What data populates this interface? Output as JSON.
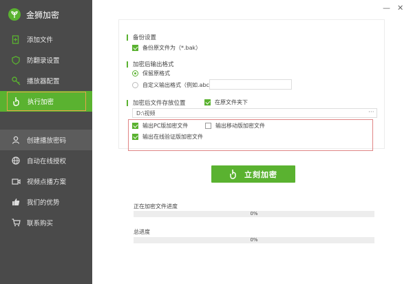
{
  "app": {
    "title": "金狮加密"
  },
  "window": {
    "minimize": "—",
    "close": "✕"
  },
  "nav_primary": [
    {
      "id": "add",
      "label": "添加文件",
      "icon": "add-file-icon"
    },
    {
      "id": "anti",
      "label": "防翻录设置",
      "icon": "shield-icon"
    },
    {
      "id": "player",
      "label": "播放器配置",
      "icon": "key-icon"
    },
    {
      "id": "exec",
      "label": "执行加密",
      "icon": "finger-icon",
      "active": true
    }
  ],
  "nav_secondary": [
    {
      "id": "pwd",
      "label": "创建播放密码",
      "icon": "user-icon",
      "selected": true
    },
    {
      "id": "auth",
      "label": "自动在线授权",
      "icon": "globe-icon"
    },
    {
      "id": "vod",
      "label": "视频点播方案",
      "icon": "video-icon"
    },
    {
      "id": "adv",
      "label": "我们的优势",
      "icon": "thumbs-up-icon"
    },
    {
      "id": "buy",
      "label": "联系购买",
      "icon": "cart-icon"
    }
  ],
  "backup": {
    "title": "备份设置",
    "option_label": "备份原文件为（*.bak）",
    "checked": true
  },
  "format": {
    "title": "加密后输出格式",
    "keep_label": "保留原格式",
    "custom_label": "自定义输出格式（例如.abc）",
    "custom_value": "",
    "keep_selected": true
  },
  "location": {
    "title": "加密后文件存放位置",
    "same_folder_label": "在原文件夹下",
    "same_folder_checked": true,
    "path": "D:\\视频",
    "browse": "···"
  },
  "outputs": {
    "pc_label": "输出PC版加密文件",
    "pc_checked": true,
    "mobile_label": "输出移动版加密文件",
    "mobile_checked": false,
    "online_label": "输出在线验证版加密文件",
    "online_checked": true
  },
  "actions": {
    "encrypt_label": "立刻加密"
  },
  "progress": {
    "current_label": "正在加密文件进度",
    "current_text": "0%",
    "current_fraction": 0,
    "total_label": "总进度",
    "total_text": "0%",
    "total_fraction": 0
  },
  "colors": {
    "accent": "#5ab230",
    "sidebar": "#4a4a4a",
    "highlight_border": "#e08585"
  }
}
